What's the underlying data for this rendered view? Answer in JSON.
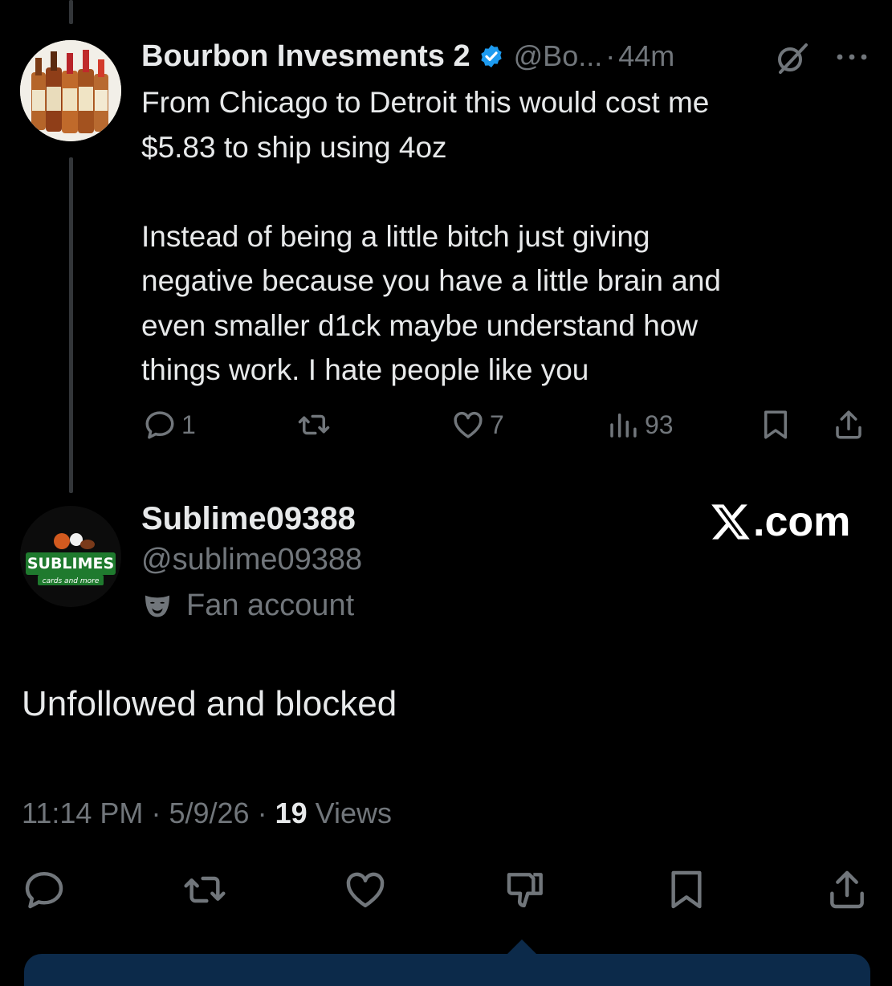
{
  "tweet": {
    "display_name": "Bourbon Invesments 2",
    "handle": "@Bo...",
    "separator": "·",
    "time": "44m",
    "text": "From Chicago to Detroit this would cost me\n$5.83 to ship using 4oz\n\nInstead of being a little bitch just giving\nnegative because you have a little brain and\neven smaller d1ck maybe understand how\nthings work.  I hate people like you",
    "replies": "1",
    "likes": "7",
    "views": "93",
    "icons": [
      "verified-badge-icon",
      "grok-icon",
      "more-icon",
      "reply-icon",
      "retweet-icon",
      "like-icon",
      "views-icon",
      "bookmark-icon",
      "share-icon"
    ]
  },
  "reply": {
    "display_name": "Sublime09388",
    "handle": "@sublime09388",
    "badge_label": "Fan account",
    "text": "Unfollowed and blocked",
    "time": "11:14 PM",
    "date": "5/9/26",
    "views_count": "19",
    "views_label": "Views",
    "avatar_logo_text": "SUBLIMES",
    "avatar_logo_subtext": "cards and more"
  },
  "watermark": {
    "suffix": ".com"
  },
  "colors": {
    "background": "#000000",
    "text": "#e7e9ea",
    "muted": "#71767b",
    "verified": "#1d9bf0"
  }
}
